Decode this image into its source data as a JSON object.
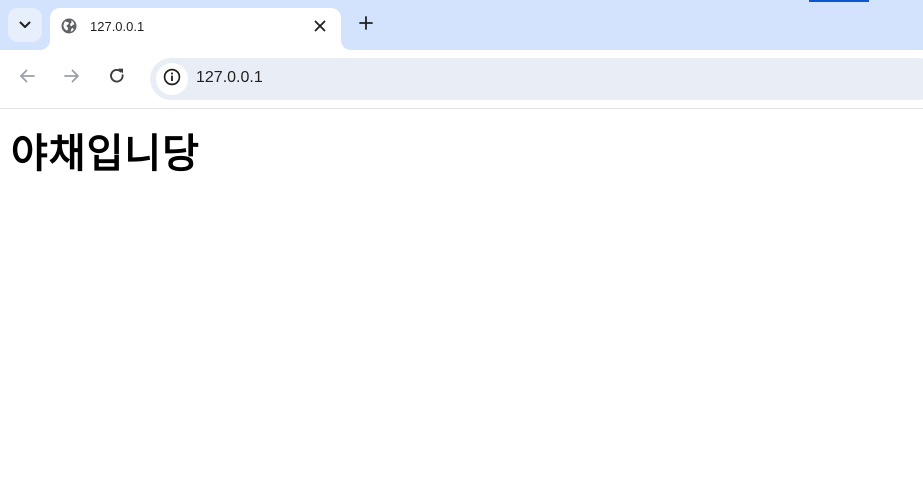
{
  "browser": {
    "tab": {
      "title": "127.0.0.1",
      "favicon": "globe-icon"
    },
    "toolbar": {
      "back_icon": "arrow-left-icon",
      "forward_icon": "arrow-right-icon",
      "reload_icon": "reload-icon",
      "site_info_icon": "info-icon",
      "url": "127.0.0.1"
    },
    "colors": {
      "tabstrip": "#d3e3fd",
      "omnibox": "#e9eef6",
      "accent": "#0b57d0"
    }
  },
  "page": {
    "heading": "야채입니당"
  }
}
